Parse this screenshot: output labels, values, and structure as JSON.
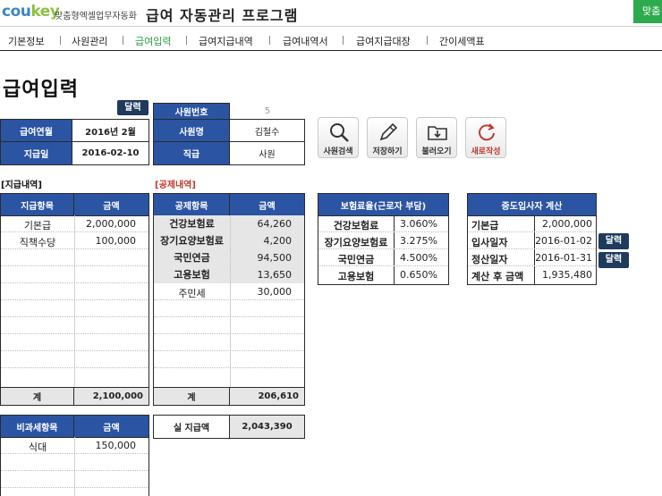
{
  "header": {
    "logo_main": "cou",
    "logo_accent": "key",
    "logo_sub": "맞춤형엑셀업무자동화",
    "app_title": "급여 자동관리 프로그램",
    "top_right_label": "맞춤"
  },
  "menu": [
    {
      "label": "기본정보"
    },
    {
      "label": "사원관리"
    },
    {
      "label": "급여입력",
      "active": true
    },
    {
      "label": "급여지급내역"
    },
    {
      "label": "급여내역서"
    },
    {
      "label": "급여지급대장"
    },
    {
      "label": "간이세액표"
    }
  ],
  "page": {
    "title": "급여입력",
    "calendar_label": "달력"
  },
  "pay_info": {
    "year_month_label": "급여연월",
    "year_month_value": "2016년 2월",
    "pay_date_label": "지급일",
    "pay_date_value": "2016-02-10"
  },
  "employee": {
    "number_label": "사원번호",
    "number_value": "5",
    "name_label": "사원명",
    "name_value": "김철수",
    "rank_label": "직급",
    "rank_value": "사원"
  },
  "actions": {
    "search": "사원검색",
    "save": "저장하기",
    "load": "불러오기",
    "new": "새로작성"
  },
  "payment": {
    "section": "[지급내역]",
    "col_item": "항목",
    "col_amount": "금액",
    "rows": [
      {
        "item": "기본급",
        "amount": "2,000,000"
      },
      {
        "item": "직책수당",
        "amount": "100,000"
      }
    ],
    "total_label": "계",
    "total_value": "2,100,000",
    "col_item_header": "지급항목"
  },
  "deduction": {
    "section": "[공제내역]",
    "col_item_header": "공제항목",
    "col_amount": "금액",
    "rows": [
      {
        "item": "건강보험료",
        "amount": "64,260"
      },
      {
        "item": "장기요양보험료",
        "amount": "4,200"
      },
      {
        "item": "국민연금",
        "amount": "94,500"
      },
      {
        "item": "고용보험",
        "amount": "13,650"
      },
      {
        "item": "주민세",
        "amount": "30,000"
      }
    ],
    "total_label": "계",
    "total_value": "206,610"
  },
  "net_pay": {
    "label": "실 지급액",
    "value": "2,043,390"
  },
  "nontaxable": {
    "col_item_header": "비과세항목",
    "col_amount": "금액",
    "rows": [
      {
        "item": "식대",
        "amount": "150,000"
      }
    ]
  },
  "insurance": {
    "title": "보험료율(근로자 부담)",
    "rows": [
      {
        "item": "건강보험료",
        "rate": "3.060%"
      },
      {
        "item": "장기요양보험료",
        "rate": "3.275%"
      },
      {
        "item": "국민연금",
        "rate": "4.500%"
      },
      {
        "item": "고용보험",
        "rate": "0.650%"
      }
    ]
  },
  "midterm": {
    "title": "중도입사자 계산",
    "base_label": "기본급",
    "base_value": "2,000,000",
    "join_label": "입사일자",
    "join_value": "2016-01-02",
    "settle_label": "정산일자",
    "settle_value": "2016-01-31",
    "calc_label": "계산 후 금액",
    "calc_value": "1,935,480"
  },
  "colors": {
    "header_blue": "#2b55a3",
    "dark_navy": "#1f3a5c",
    "active_green": "#2e9a48",
    "red": "#c0392b"
  }
}
